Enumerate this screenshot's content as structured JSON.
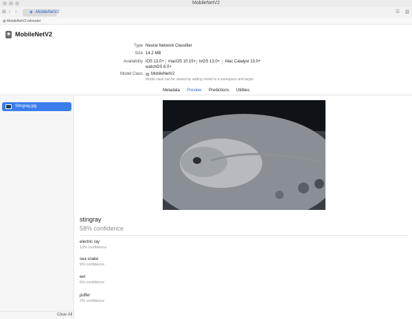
{
  "window": {
    "title": "MobileNetV2"
  },
  "toolbar": {
    "tab_label": "MobileNetV2"
  },
  "pathbar": {
    "path": "MobileNetV2.mlmodel"
  },
  "model": {
    "name": "MobileNetV2"
  },
  "metadata": {
    "type_key": "Type",
    "type_val": "Neural Network Classifier",
    "size_key": "Size",
    "size_val": "14.2 MB",
    "availability_key": "Availability",
    "availability": [
      "iOS 13.0+",
      "macOS 10.15+",
      "tvOS 13.0+",
      "Mac Catalyst 13.0+",
      "watchOS 6.0+"
    ],
    "class_key": "Model Class",
    "class_val": "MobileNetV2",
    "class_note": "Model class can be viewed by adding model to a workspace and target."
  },
  "tabs": [
    "Metadata",
    "Preview",
    "Predictions",
    "Utilities"
  ],
  "active_tab": "Preview",
  "sidebar": {
    "items": [
      {
        "label": "Stingray.jpg"
      }
    ],
    "clear_all": "Clear All"
  },
  "result": {
    "label": "stingray",
    "confidence": "58% confidence"
  },
  "predictions": [
    {
      "label": "electric ray",
      "confidence": "13% confidence"
    },
    {
      "label": "sea snake",
      "confidence": "9% confidence"
    },
    {
      "label": "eel",
      "confidence": "6% confidence"
    },
    {
      "label": "puffer",
      "confidence": "2% confidence"
    }
  ],
  "colors": {
    "accent": "#3b7ded",
    "link": "#2d68c4"
  }
}
